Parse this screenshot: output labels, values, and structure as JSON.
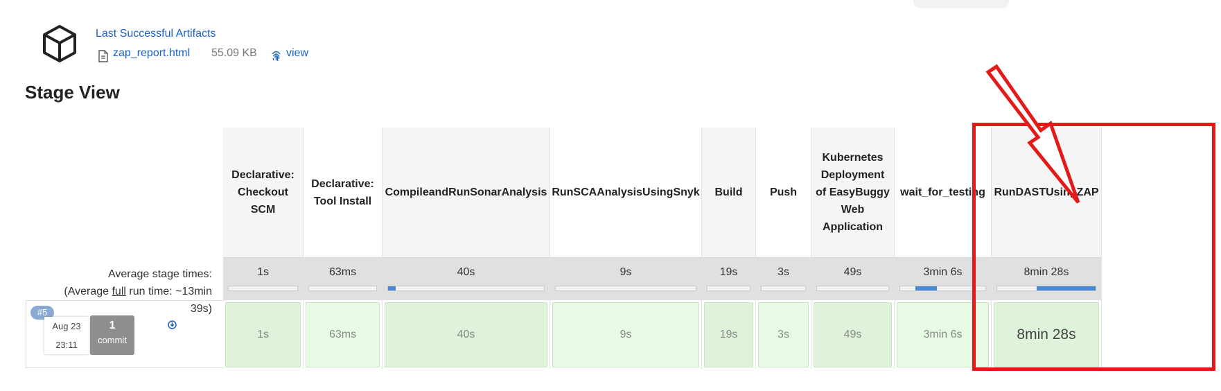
{
  "artifacts": {
    "title": "Last Successful Artifacts",
    "file_name": "zap_report.html",
    "file_size": "55.09 KB",
    "view_label": "view"
  },
  "stage_view": {
    "title": "Stage View",
    "avg_label_line1": "Average stage times:",
    "avg_label_line2_pre": "(Average ",
    "avg_label_line2_full": "full",
    "avg_label_line2_post": " run time: ~13min",
    "avg_label_line3": "39s)",
    "stages": [
      {
        "name": "Declarative: Checkout SCM",
        "avg": "1s",
        "run": "1s",
        "avg_fraction": 0.0
      },
      {
        "name": "Declarative: Tool Install",
        "avg": "63ms",
        "run": "63ms",
        "avg_fraction": 0.0
      },
      {
        "name": "CompileandRunSonarAnalysis",
        "avg": "40s",
        "run": "40s",
        "avg_fraction": 0.05
      },
      {
        "name": "RunSCAAnalysisUsingSnyk",
        "avg": "9s",
        "run": "9s",
        "avg_fraction": 0.0
      },
      {
        "name": "Build",
        "avg": "19s",
        "run": "19s",
        "avg_fraction": 0.0
      },
      {
        "name": "Push",
        "avg": "3s",
        "run": "3s",
        "avg_fraction": 0.0
      },
      {
        "name": "Kubernetes Deployment of EasyBuggy Web Application",
        "avg": "49s",
        "run": "49s",
        "avg_fraction": 0.0
      },
      {
        "name": "wait_for_testing",
        "avg": "3min 6s",
        "run": "3min 6s",
        "avg_fraction": 0.25
      },
      {
        "name": "RunDASTUsingZAP",
        "avg": "8min 28s",
        "run": "8min 28s",
        "avg_fraction": 0.6
      }
    ]
  },
  "run": {
    "badge": "#5",
    "date": "Aug 23",
    "time": "23:11",
    "commit_count": "1",
    "commit_label": "commit"
  },
  "colors": {
    "link": "#1a5fc9",
    "success_cell": "#dff3db",
    "annotation": "#e21a1a"
  }
}
